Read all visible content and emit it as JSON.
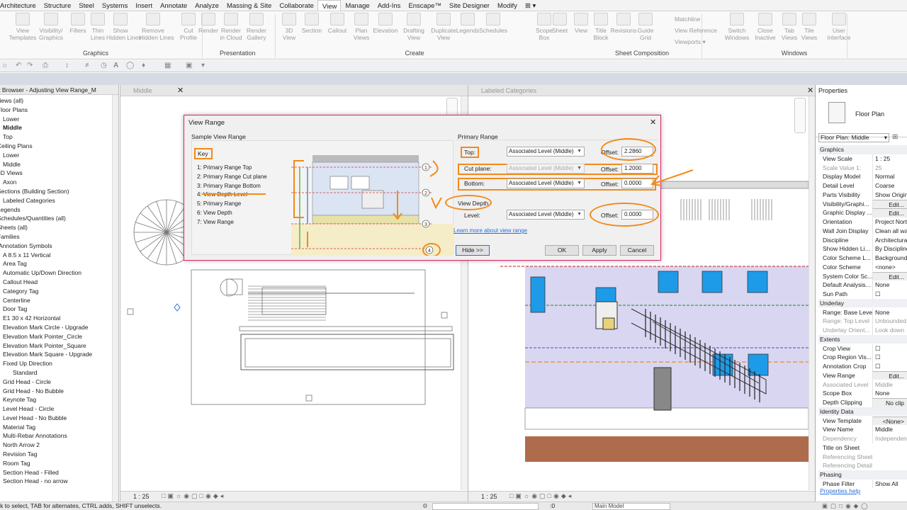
{
  "menu": [
    "Architecture",
    "Structure",
    "Steel",
    "Systems",
    "Insert",
    "Annotate",
    "Analyze",
    "Massing & Site",
    "Collaborate",
    "View",
    "Manage",
    "Add-Ins",
    "Enscape™",
    "Site Designer",
    "Modify",
    "⊞ ▾"
  ],
  "ribbon": {
    "buttons": [
      {
        "label": "View\nTemplates"
      },
      {
        "label": "Visibility/\nGraphics"
      },
      {
        "label": "Filters"
      },
      {
        "label": "Thin\nLines"
      },
      {
        "label": "Show\nHidden Lines"
      },
      {
        "label": "Remove\nHidden Lines"
      },
      {
        "label": "Cut\nProfile"
      },
      {
        "label": "Render"
      },
      {
        "label": "Render\nin Cloud"
      },
      {
        "label": "Render\nGallery"
      },
      {
        "label": "3D\nView"
      },
      {
        "label": "Section"
      },
      {
        "label": "Callout"
      },
      {
        "label": "Plan\nViews"
      },
      {
        "label": "Elevation"
      },
      {
        "label": "Drafting\nView"
      },
      {
        "label": "Duplicate\nView"
      },
      {
        "label": "Legends"
      },
      {
        "label": "Schedules"
      },
      {
        "label": "Scope\nBox"
      },
      {
        "label": "Sheet"
      },
      {
        "label": "View"
      },
      {
        "label": "Title\nBlock"
      },
      {
        "label": "Revisions"
      },
      {
        "label": "Guide\nGrid"
      },
      {
        "label": "Switch\nWindows"
      },
      {
        "label": "Close\nInactive"
      },
      {
        "label": "Tab\nViews"
      },
      {
        "label": "Tile\nViews"
      },
      {
        "label": "User\nInterface"
      }
    ],
    "small": [
      "Matchline",
      "View Reference",
      "Viewports ▾"
    ],
    "groups": [
      "Graphics",
      "Presentation",
      "Create",
      "Sheet Composition",
      "Windows"
    ]
  },
  "browser": {
    "title": "Project Browser - Adjusting View Range_M",
    "items": [
      {
        "t": "Views (all)",
        "b": false
      },
      {
        "t": "Floor Plans",
        "b": false
      },
      {
        "t": "Lower",
        "b": false
      },
      {
        "t": "Middle",
        "b": true
      },
      {
        "t": "Top",
        "b": false
      },
      {
        "t": "Ceiling Plans",
        "b": false
      },
      {
        "t": "Lower",
        "b": false
      },
      {
        "t": "Middle",
        "b": false
      },
      {
        "t": "3D Views",
        "b": false
      },
      {
        "t": "Axon",
        "b": false
      },
      {
        "t": "Sections (Building Section)",
        "b": false
      },
      {
        "t": "Labeled Categories",
        "b": false
      },
      {
        "t": "Legends",
        "b": false
      },
      {
        "t": "Schedules/Quantities (all)",
        "b": false
      },
      {
        "t": "Sheets (all)",
        "b": false
      },
      {
        "t": "Families",
        "b": false
      },
      {
        "t": "Annotation Symbols",
        "b": false
      },
      {
        "t": "A 8.5 x 11 Vertical",
        "b": false
      },
      {
        "t": "Area Tag",
        "b": false
      },
      {
        "t": "Automatic Up/Down Direction",
        "b": false
      },
      {
        "t": "Callout Head",
        "b": false
      },
      {
        "t": "Category Tag",
        "b": false
      },
      {
        "t": "Centerline",
        "b": false
      },
      {
        "t": "Door Tag",
        "b": false
      },
      {
        "t": "E1 30 x 42 Horizontal",
        "b": false
      },
      {
        "t": "Elevation Mark Circle - Upgrade",
        "b": false
      },
      {
        "t": "Elevation Mark Pointer_Circle",
        "b": false
      },
      {
        "t": "Elevation Mark Pointer_Square",
        "b": false
      },
      {
        "t": "Elevation Mark Square - Upgrade",
        "b": false
      },
      {
        "t": "Fixed Up Direction",
        "b": false
      },
      {
        "t": "Standard",
        "b": false
      },
      {
        "t": "Grid Head - Circle",
        "b": false
      },
      {
        "t": "Grid Head - No Bubble",
        "b": false
      },
      {
        "t": "Keynote Tag",
        "b": false
      },
      {
        "t": "Level Head - Circle",
        "b": false
      },
      {
        "t": "Level Head - No Bubble",
        "b": false
      },
      {
        "t": "Material Tag",
        "b": false
      },
      {
        "t": "Multi-Rebar Annotations",
        "b": false
      },
      {
        "t": "North Arrow 2",
        "b": false
      },
      {
        "t": "Revision Tag",
        "b": false
      },
      {
        "t": "Room Tag",
        "b": false
      },
      {
        "t": "Section Head - Filled",
        "b": false
      },
      {
        "t": "Section Head - no arrow",
        "b": false
      }
    ]
  },
  "view_left": {
    "tab": "Middle",
    "scale": "1 : 25"
  },
  "view_right": {
    "tab": "Labeled Categories",
    "scale": "1 : 25"
  },
  "properties": {
    "title": "Properties",
    "type": "Floor Plan",
    "selector": "Floor Plan: Middle",
    "edit_type": "⊞",
    "rows": [
      {
        "k": "Graphics",
        "v": "",
        "h": true
      },
      {
        "k": "View Scale",
        "v": "1 : 25"
      },
      {
        "k": "Scale Value    1:",
        "v": "25",
        "g": true
      },
      {
        "k": "Display Model",
        "v": "Normal"
      },
      {
        "k": "Detail Level",
        "v": "Coarse"
      },
      {
        "k": "Parts Visibility",
        "v": "Show Original"
      },
      {
        "k": "Visibility/Graphi...",
        "v": "Edit...",
        "e": true
      },
      {
        "k": "Graphic Display ...",
        "v": "Edit...",
        "e": true
      },
      {
        "k": "Orientation",
        "v": "Project North"
      },
      {
        "k": "Wall Join Display",
        "v": "Clean all wall"
      },
      {
        "k": "Discipline",
        "v": "Architectural"
      },
      {
        "k": "Show Hidden Li...",
        "v": "By Discipline"
      },
      {
        "k": "Color Scheme L...",
        "v": "Background"
      },
      {
        "k": "Color Scheme",
        "v": "<none>"
      },
      {
        "k": "System Color Sc...",
        "v": "Edit...",
        "e": true
      },
      {
        "k": "Default Analysis...",
        "v": "None"
      },
      {
        "k": "Sun Path",
        "v": "☐"
      },
      {
        "k": "Underlay",
        "v": "",
        "h": true
      },
      {
        "k": "Range: Base Level",
        "v": "None"
      },
      {
        "k": "Range: Top Level",
        "v": "Unbounded",
        "g": true
      },
      {
        "k": "Underlay Orient...",
        "v": "Look down",
        "g": true
      },
      {
        "k": "Extents",
        "v": "",
        "h": true
      },
      {
        "k": "Crop View",
        "v": "☐"
      },
      {
        "k": "Crop Region Vis...",
        "v": "☐"
      },
      {
        "k": "Annotation Crop",
        "v": "☐"
      },
      {
        "k": "View Range",
        "v": "Edit...",
        "e": true
      },
      {
        "k": "Associated Level",
        "v": "Middle",
        "g": true
      },
      {
        "k": "Scope Box",
        "v": "None"
      },
      {
        "k": "Depth Clipping",
        "v": "No clip",
        "e": true
      },
      {
        "k": "Identity Data",
        "v": "",
        "h": true
      },
      {
        "k": "View Template",
        "v": "<None>",
        "e": true
      },
      {
        "k": "View Name",
        "v": "Middle"
      },
      {
        "k": "Dependency",
        "v": "Independent",
        "g": true
      },
      {
        "k": "Title on Sheet",
        "v": ""
      },
      {
        "k": "Referencing Sheet",
        "v": "",
        "g": true
      },
      {
        "k": "Referencing Detail",
        "v": "",
        "g": true
      },
      {
        "k": "Phasing",
        "v": "",
        "h": true
      },
      {
        "k": "Phase Filter",
        "v": "Show All"
      }
    ],
    "help": "Properties help"
  },
  "dialog": {
    "title": "View Range",
    "sample_label": "Sample View Range",
    "key_label": "Key",
    "key_items": [
      "1: Primary Range Top",
      "2: Primary Range Cut plane",
      "3: Primary Range Bottom",
      "4: View Depth Level",
      "5: Primary Range",
      "6: View Depth",
      "7: View Range"
    ],
    "primary_label": "Primary Range",
    "top_label": "Top:",
    "cut_label": "Cut plane:",
    "bottom_label": "Bottom:",
    "view_depth_label": "View Depth",
    "level_label": "Level:",
    "level_value": "Associated Level (Middle)",
    "offset_label": "Offset:",
    "top_offset": "2.2860",
    "cut_offset": "1.2000",
    "bottom_offset": "0.0000",
    "depth_offset": "0.0000",
    "learn": "Learn more about view range",
    "hide": "Hide >>",
    "ok": "OK",
    "apply": "Apply",
    "cancel": "Cancel"
  },
  "status": {
    "hint": "Click to select, TAB for alternates, CTRL adds, SHIFT unselects.",
    "coord": ":0",
    "model": "Main Model"
  },
  "colors": {
    "annotation": "#f28a1a",
    "accent": "#2a6fdb"
  }
}
